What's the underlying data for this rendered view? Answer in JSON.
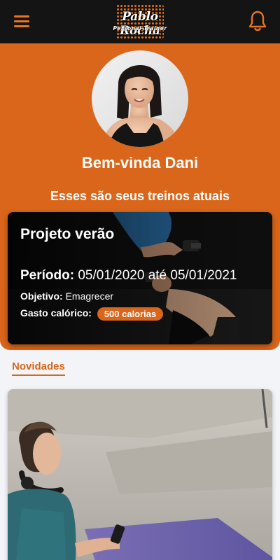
{
  "header": {
    "logo_title": "Pablo Rocha",
    "logo_subtitle": "Personal Trainer",
    "menu_icon": "hamburger-menu-icon",
    "notification_icon": "bell-icon"
  },
  "hero": {
    "welcome": "Bem-vinda Dani",
    "subtitle": "Esses são seus treinos atuais"
  },
  "workout_card": {
    "title": "Projeto verão",
    "period_label": "Período:",
    "period_value": "05/01/2020 até 05/01/2021",
    "objective_label": "Objetivo:",
    "objective_value": "Emagrecer",
    "calories_label": "Gasto calórico:",
    "calories_value": "500 calorias"
  },
  "news": {
    "title": "Novidades"
  },
  "colors": {
    "accent": "#d9661a",
    "topbar": "#141414",
    "background": "#f3f4f8"
  }
}
